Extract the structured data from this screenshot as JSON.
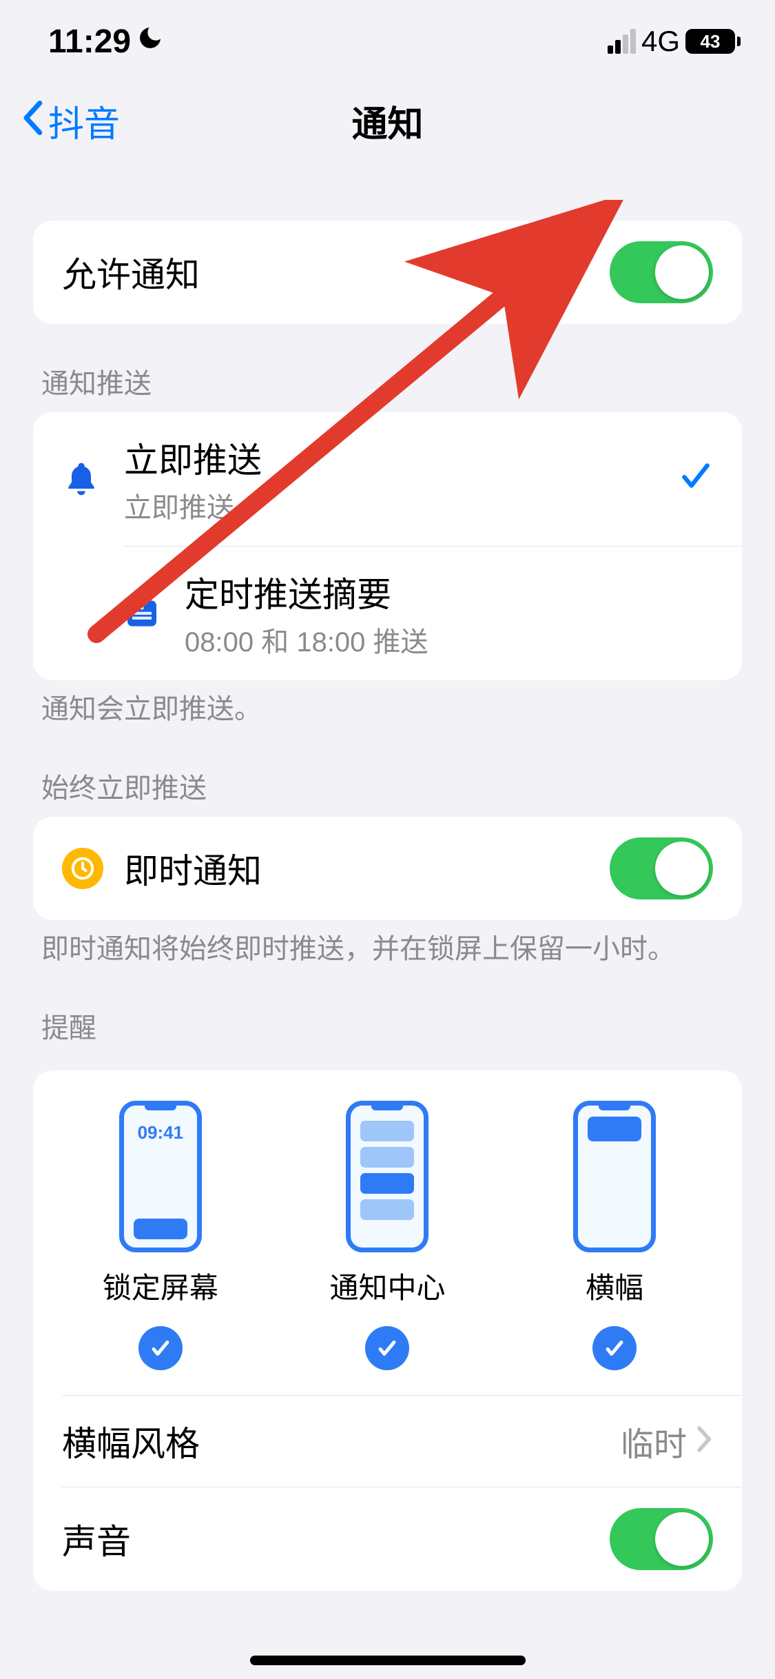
{
  "status": {
    "time": "11:29",
    "dnd_icon": "moon-icon",
    "network_type": "4G",
    "battery_pct": "43"
  },
  "nav": {
    "back_label": "抖音",
    "title": "通知"
  },
  "allow": {
    "label": "允许通知",
    "on": true
  },
  "delivery": {
    "header": "通知推送",
    "footer": "通知会立即推送。",
    "immediate": {
      "title": "立即推送",
      "sub": "立即推送",
      "selected": true,
      "icon": "bell-icon"
    },
    "scheduled": {
      "title": "定时推送摘要",
      "sub": "08:00 和 18:00 推送",
      "selected": false,
      "icon": "newspaper-icon"
    }
  },
  "always_immediate": {
    "header": "始终立即推送",
    "footer": "即时通知将始终即时推送，并在锁屏上保留一小时。",
    "row": {
      "title": "即时通知",
      "on": true,
      "icon": "clock-badge-icon"
    }
  },
  "alerts": {
    "header": "提醒",
    "options": {
      "lock_screen": {
        "label": "锁定屏幕",
        "checked": true,
        "time_glyph": "09:41"
      },
      "notification_center": {
        "label": "通知中心",
        "checked": true
      },
      "banners": {
        "label": "横幅",
        "checked": true
      }
    },
    "banner_style": {
      "label": "横幅风格",
      "value": "临时"
    },
    "sound": {
      "label": "声音",
      "on": true
    }
  }
}
